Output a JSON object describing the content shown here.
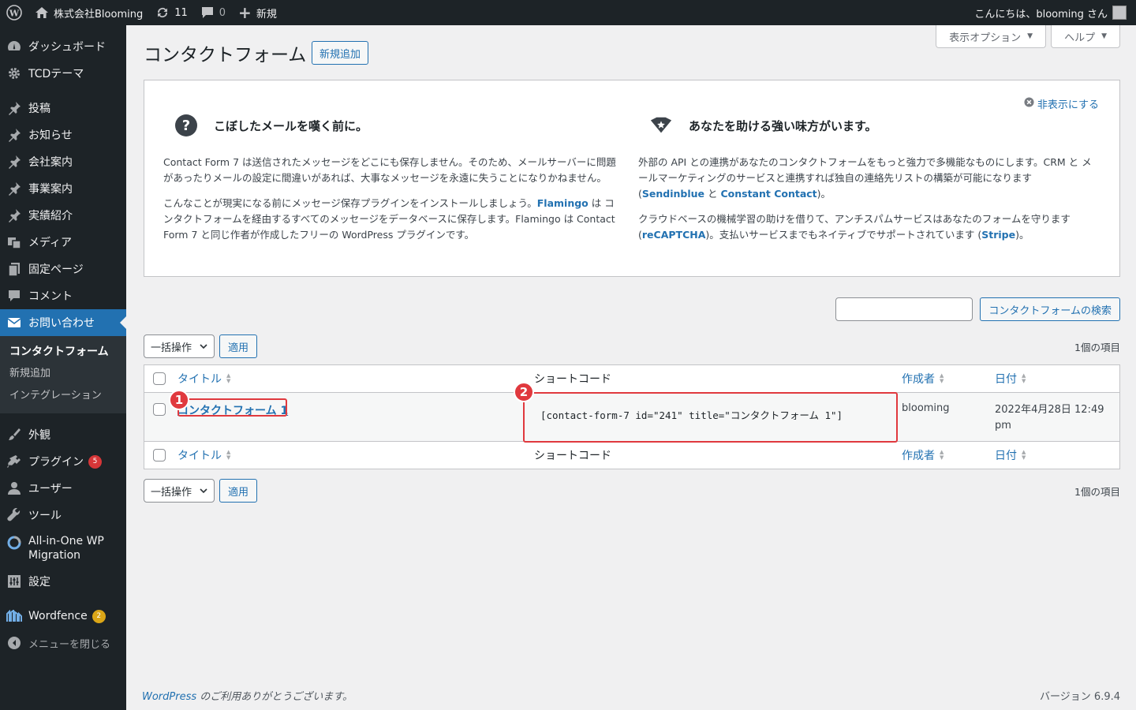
{
  "admin_bar": {
    "site_name": "株式会社Blooming",
    "updates_count": "11",
    "comments_count": "0",
    "new_label": "新規",
    "greeting": "こんにちは、blooming さん"
  },
  "sidebar": {
    "items": [
      {
        "label": "ダッシュボード",
        "icon": "dashboard-icon"
      },
      {
        "label": "TCDテーマ",
        "icon": "gear-icon"
      },
      {
        "label": "投稿",
        "icon": "pin-icon"
      },
      {
        "label": "お知らせ",
        "icon": "pin-icon"
      },
      {
        "label": "会社案内",
        "icon": "pin-icon"
      },
      {
        "label": "事業案内",
        "icon": "pin-icon"
      },
      {
        "label": "実績紹介",
        "icon": "pin-icon"
      },
      {
        "label": "メディア",
        "icon": "media-icon"
      },
      {
        "label": "固定ページ",
        "icon": "page-icon"
      },
      {
        "label": "コメント",
        "icon": "comment-icon"
      },
      {
        "label": "お問い合わせ",
        "icon": "mail-icon"
      },
      {
        "label": "外観",
        "icon": "brush-icon"
      },
      {
        "label": "プラグイン",
        "icon": "plugin-icon",
        "badge": "5"
      },
      {
        "label": "ユーザー",
        "icon": "user-icon"
      },
      {
        "label": "ツール",
        "icon": "wrench-icon"
      },
      {
        "label": "All-in-One WP Migration",
        "icon": "migration-icon"
      },
      {
        "label": "設定",
        "icon": "settings-icon"
      },
      {
        "label": "Wordfence",
        "icon": "wordfence-icon",
        "badge": "2"
      },
      {
        "label": "メニューを閉じる",
        "icon": "collapse-icon"
      }
    ],
    "submenu": [
      "コンタクトフォーム",
      "新規追加",
      "インテグレーション"
    ]
  },
  "screen_tabs": {
    "options": "表示オプション",
    "help": "ヘルプ"
  },
  "page": {
    "title": "コンタクトフォーム",
    "add_new": "新規追加"
  },
  "welcome": {
    "dismiss": "非表示にする",
    "left": {
      "heading": "こぼしたメールを嘆く前に。",
      "p1": "Contact Form 7 は送信されたメッセージをどこにも保存しません。そのため、メールサーバーに問題があったりメールの設定に間違いがあれば、大事なメッセージを永遠に失うことになりかねません。",
      "p2_a": "こんなことが現実になる前にメッセージ保存プラグインをインストールしましょう。",
      "p2_link": "Flamingo",
      "p2_b": " は コンタクトフォームを経由するすべてのメッセージをデータベースに保存します。Flamingo は Contact Form 7 と同じ作者が作成したフリーの WordPress プラグインです。"
    },
    "right": {
      "heading": "あなたを助ける強い味方がいます。",
      "p1_a": "外部の API との連携があなたのコンタクトフォームをもっと強力で多機能なものにします。CRM と メールマーケティングのサービスと連携すれば独自の連絡先リストの構築が可能になります (",
      "p1_link1": "Sendinblue",
      "p1_mid": " と ",
      "p1_link2": "Constant Contact",
      "p1_b": ")。",
      "p2_a": "クラウドベースの機械学習の助けを借りて、アンチスパムサービスはあなたのフォームを守ります (",
      "p2_link1": "reCAPTCHA",
      "p2_mid": ")。支払いサービスまでもネイティブでサポートされています (",
      "p2_link2": "Stripe",
      "p2_b": ")。"
    }
  },
  "search": {
    "button": "コンタクトフォームの検索",
    "value": ""
  },
  "tablenav": {
    "bulk": "一括操作",
    "apply": "適用",
    "count": "1個の項目"
  },
  "table": {
    "columns": {
      "title": "タイトル",
      "shortcode": "ショートコード",
      "author": "作成者",
      "date": "日付"
    },
    "rows": [
      {
        "title": "コンタクトフォーム 1",
        "shortcode": "[contact-form-7 id=\"241\" title=\"コンタクトフォーム 1\"]",
        "author": "blooming",
        "date_line1": "2022年4月28日 12:49",
        "date_line2": "pm"
      }
    ]
  },
  "annotations": {
    "one": "1",
    "two": "2"
  },
  "footer": {
    "wp_link": "WordPress",
    "thanks": " のご利用ありがとうございます。",
    "version": "バージョン 6.9.4"
  }
}
